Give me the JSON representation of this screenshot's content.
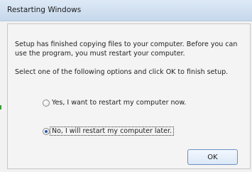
{
  "window": {
    "title": "Restarting Windows"
  },
  "body": {
    "line1": "Setup has finished copying files to your computer.  Before you can",
    "line2": "use the program, you must restart your computer.",
    "instruction": "Select one of the following options and click OK to finish setup."
  },
  "options": [
    {
      "label": "Yes, I want to restart my computer now.",
      "selected": false
    },
    {
      "label": "No, I will restart my computer later.",
      "selected": true
    }
  ],
  "buttons": {
    "ok_label": "OK"
  }
}
